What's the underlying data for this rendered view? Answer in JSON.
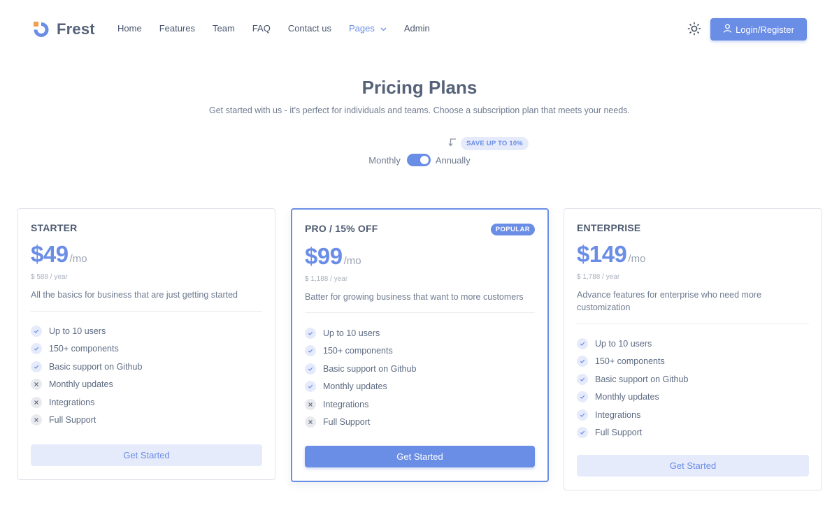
{
  "brand": {
    "name": "Frest",
    "logo_icon": "frest-logo-icon",
    "accent_color": "#6a8de6",
    "logo_square_color": "#f0a04a"
  },
  "nav": {
    "items": [
      {
        "label": "Home",
        "active": false
      },
      {
        "label": "Features",
        "active": false
      },
      {
        "label": "Team",
        "active": false
      },
      {
        "label": "FAQ",
        "active": false
      },
      {
        "label": "Contact us",
        "active": false
      },
      {
        "label": "Pages",
        "active": true,
        "has_dropdown": true
      },
      {
        "label": "Admin",
        "active": false
      }
    ],
    "theme_icon": "sun-icon",
    "login_label": "Login/Register",
    "login_icon": "user-icon"
  },
  "header": {
    "title": "Pricing Plans",
    "subtitle": "Get started with us - it's perfect for individuals and teams. Choose a subscription plan that meets your needs."
  },
  "billing": {
    "monthly_label": "Monthly",
    "annually_label": "Annually",
    "annual_selected": true,
    "save_badge": "SAVE UP TO 10%"
  },
  "plans": [
    {
      "name": "STARTER",
      "price": "$49",
      "period": "/mo",
      "yearly": "$ 588 / year",
      "description": "All the basics for business that are just getting started",
      "popular": false,
      "features": [
        {
          "label": "Up to 10 users",
          "included": true
        },
        {
          "label": "150+ components",
          "included": true
        },
        {
          "label": "Basic support on Github",
          "included": true
        },
        {
          "label": "Monthly updates",
          "included": false
        },
        {
          "label": "Integrations",
          "included": false
        },
        {
          "label": "Full Support",
          "included": false
        }
      ],
      "cta": "Get Started"
    },
    {
      "name": "PRO / 15% OFF",
      "price": "$99",
      "period": "/mo",
      "yearly": "$ 1,188 / year",
      "description": "Batter for growing business that want to more customers",
      "popular": true,
      "popular_label": "POPULAR",
      "features": [
        {
          "label": "Up to 10 users",
          "included": true
        },
        {
          "label": "150+ components",
          "included": true
        },
        {
          "label": "Basic support on Github",
          "included": true
        },
        {
          "label": "Monthly updates",
          "included": true
        },
        {
          "label": "Integrations",
          "included": false
        },
        {
          "label": "Full Support",
          "included": false
        }
      ],
      "cta": "Get Started"
    },
    {
      "name": "ENTERPRISE",
      "price": "$149",
      "period": "/mo",
      "yearly": "$ 1,788 / year",
      "description": "Advance features for enterprise who need more customization",
      "popular": false,
      "features": [
        {
          "label": "Up to 10 users",
          "included": true
        },
        {
          "label": "150+ components",
          "included": true
        },
        {
          "label": "Basic support on Github",
          "included": true
        },
        {
          "label": "Monthly updates",
          "included": true
        },
        {
          "label": "Integrations",
          "included": true
        },
        {
          "label": "Full Support",
          "included": true
        }
      ],
      "cta": "Get Started"
    }
  ]
}
